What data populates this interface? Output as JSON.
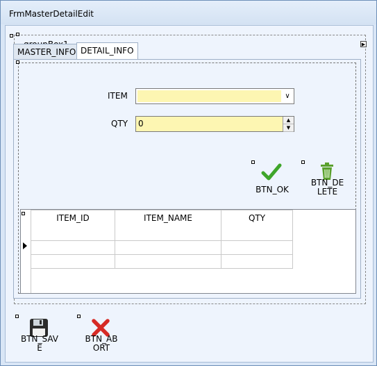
{
  "window": {
    "title": "FrmMasterDetailEdit"
  },
  "groupbox": {
    "label": "groupBox1"
  },
  "tabs": [
    {
      "label": "MASTER_INFO",
      "active": false
    },
    {
      "label": "DETAIL_INFO",
      "active": true
    }
  ],
  "form": {
    "item_label": "ITEM",
    "item_value": "",
    "qty_label": "QTY",
    "qty_value": "0"
  },
  "buttons": {
    "ok_label": "BTN_OK",
    "delete_label_1": "BTN_DE",
    "delete_label_2": "LETE",
    "save_label_1": "BTN_SAV",
    "save_label_2": "E",
    "abort_label_1": "BTN_AB",
    "abort_label_2": "ORT"
  },
  "grid": {
    "columns": [
      "ITEM_ID",
      "ITEM_NAME",
      "QTY"
    ],
    "rows": [
      [
        "",
        "",
        ""
      ],
      [
        "",
        "",
        ""
      ]
    ]
  },
  "colors": {
    "ok_icon": "#3ea52a",
    "delete_icon": "#5aa02c",
    "abort_icon": "#d62a25",
    "field_bg": "#fdf6b2"
  },
  "icons": {
    "ok": "check-icon",
    "delete": "trash-icon",
    "save": "floppy-icon",
    "abort": "x-icon"
  }
}
